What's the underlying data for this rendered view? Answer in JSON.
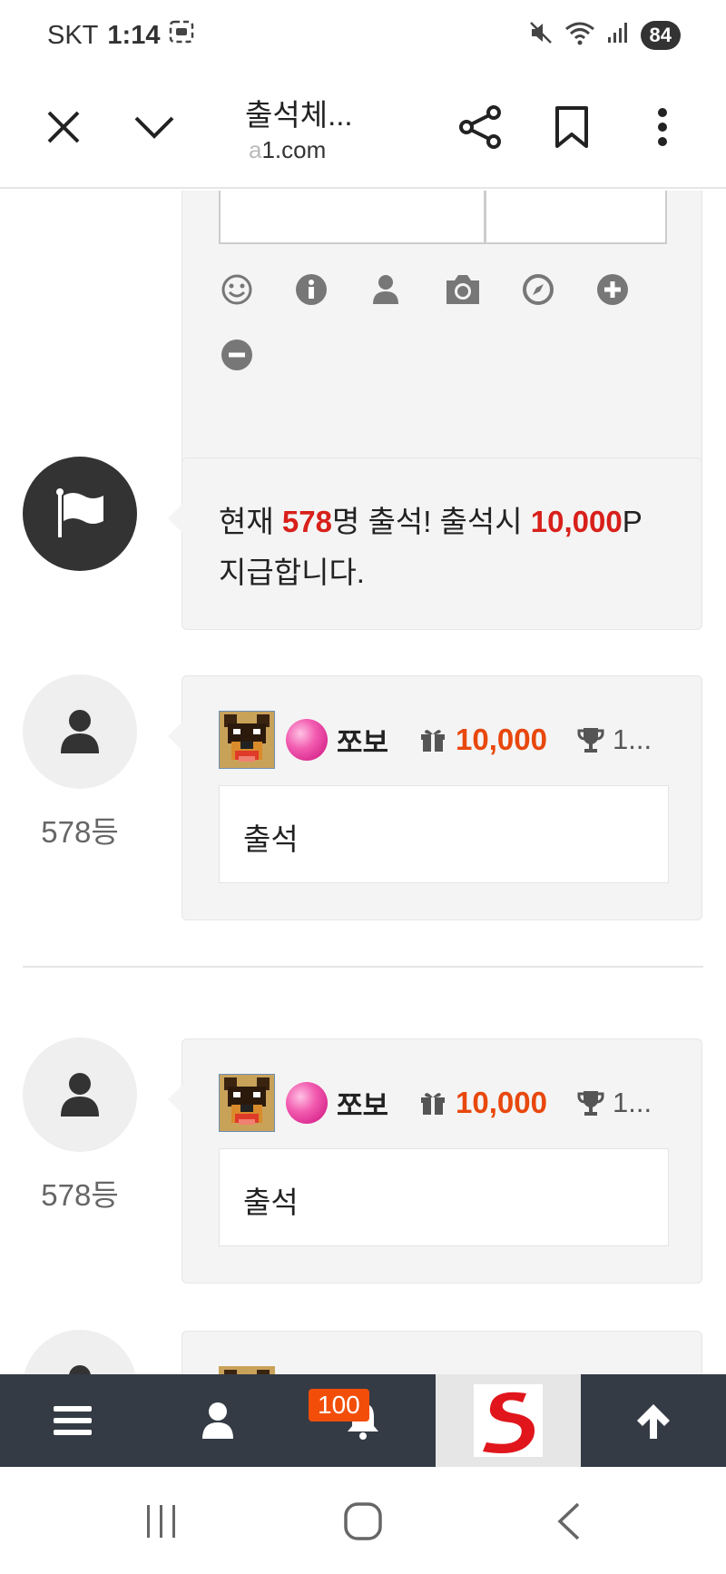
{
  "status_bar": {
    "carrier": "SKT",
    "time": "1:14",
    "battery": "84"
  },
  "browser": {
    "title": "출석체...",
    "url_prefix": "",
    "url_fade": "a",
    "url_rest": "1.com"
  },
  "editor": {
    "tools": [
      "smile-icon",
      "info-icon",
      "user-icon",
      "camera-icon",
      "compass-icon",
      "plus-circle-icon",
      "minus-circle-icon"
    ]
  },
  "notice": {
    "t1": "현재 ",
    "count": "578",
    "t2": "명 출석! 출석시 ",
    "points": "10,000",
    "t3": "P 지급합니다."
  },
  "entries": [
    {
      "rank": "578등",
      "nick": "쪼보",
      "points": "10,000",
      "trophy": "1...",
      "comment": "출석"
    },
    {
      "rank": "578등",
      "nick": "쪼보",
      "points": "10,000",
      "trophy": "1...",
      "comment": "출석"
    }
  ],
  "bottom_nav": {
    "badge": "100",
    "accent": "#f24e0a",
    "bg": "#343b45"
  }
}
